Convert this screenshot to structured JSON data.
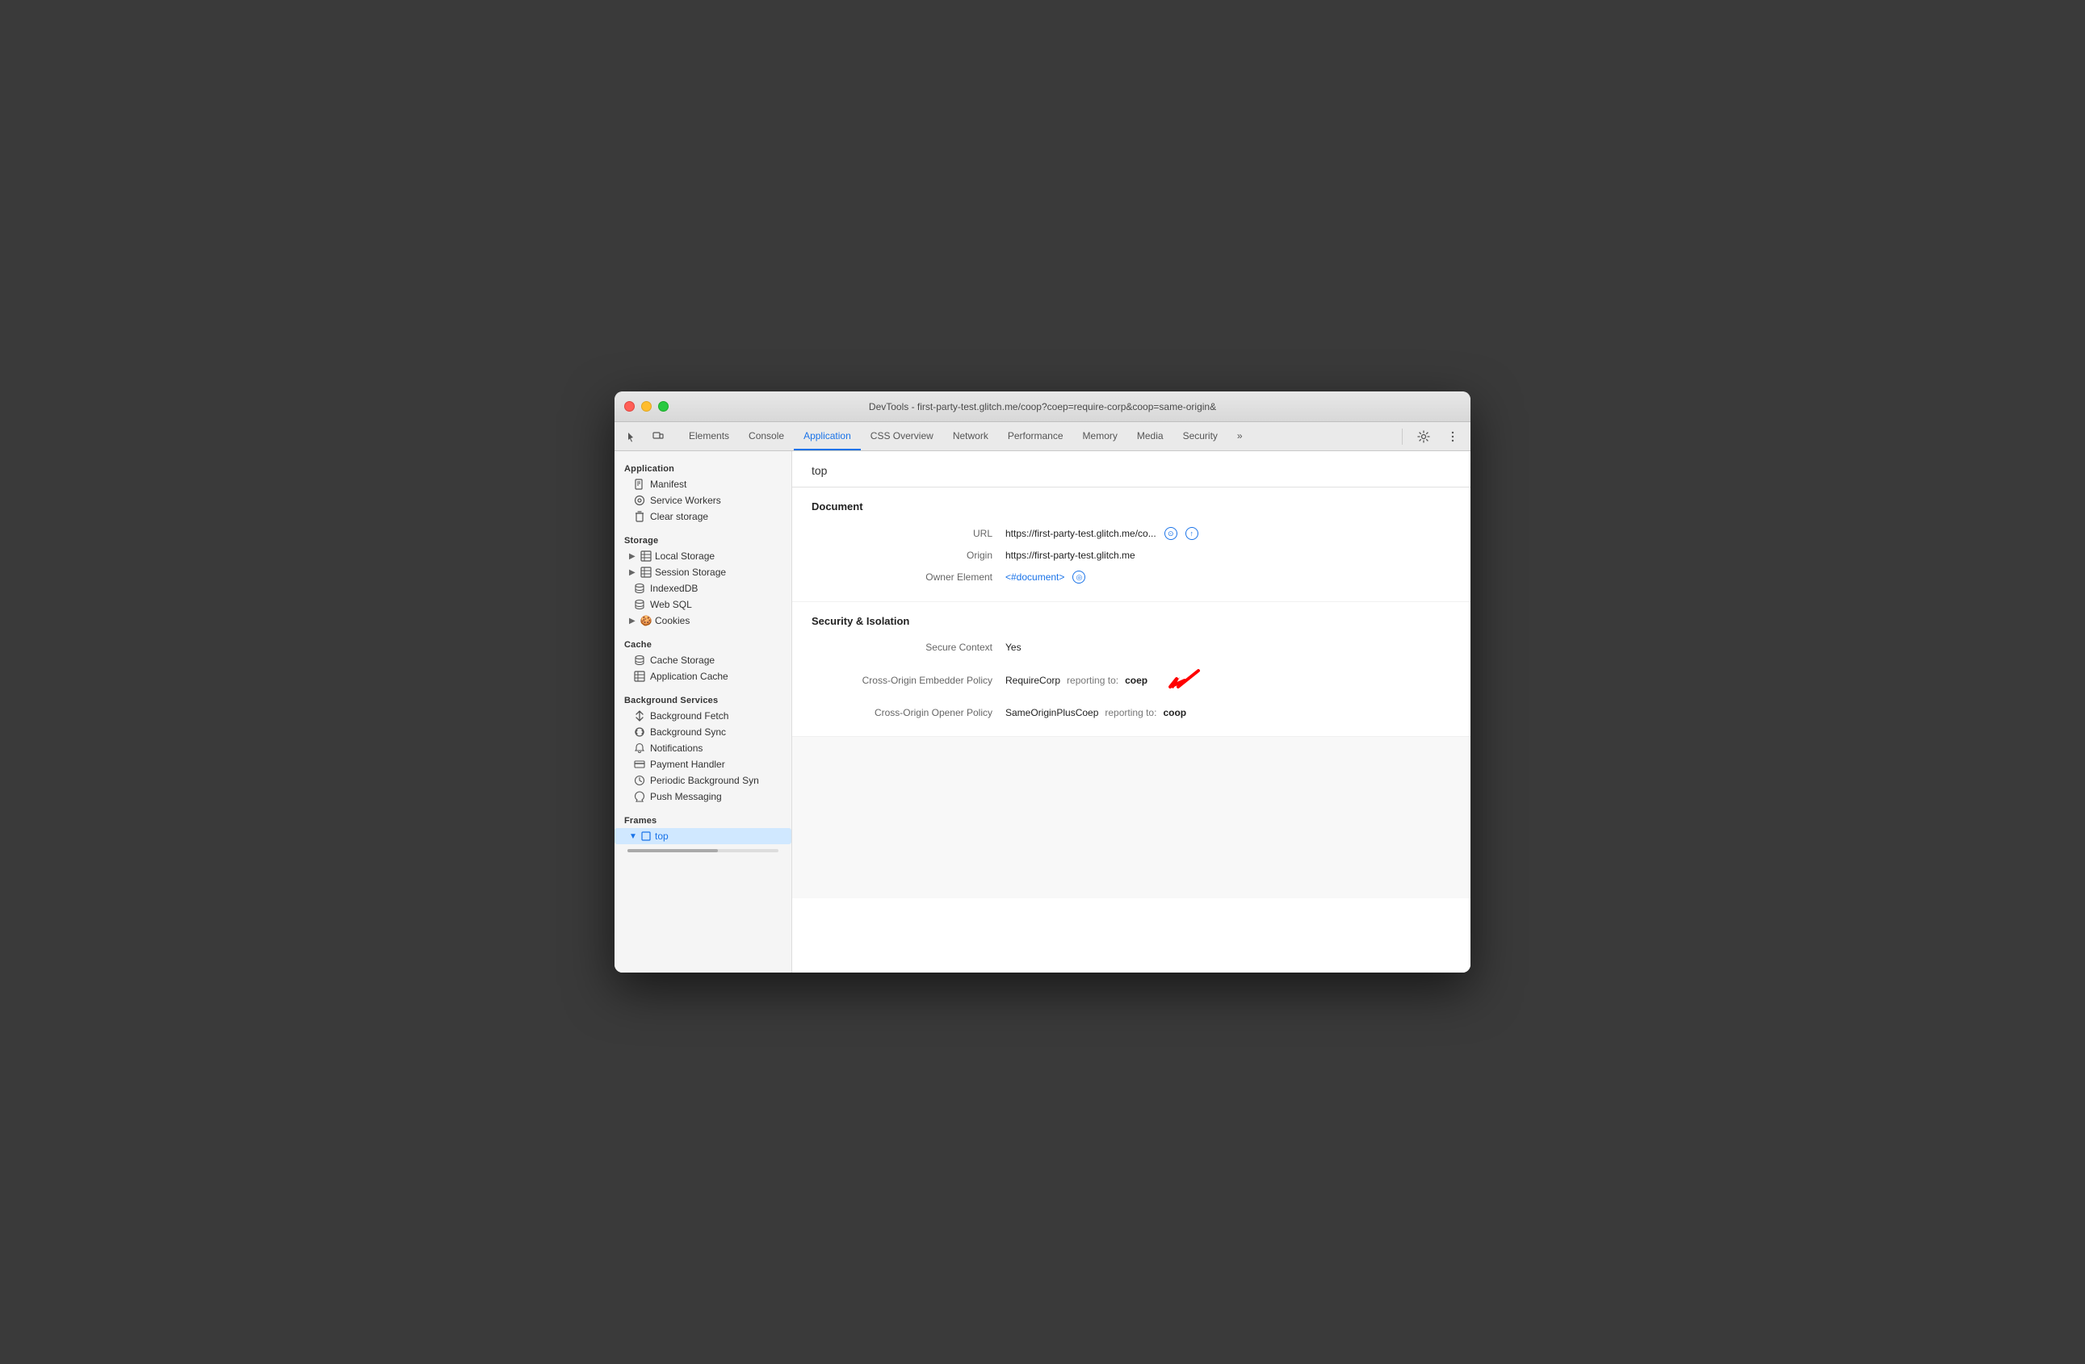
{
  "window": {
    "title": "DevTools - first-party-test.glitch.me/coop?coep=require-corp&coop=same-origin&"
  },
  "tabs": [
    {
      "id": "elements",
      "label": "Elements",
      "active": false
    },
    {
      "id": "console",
      "label": "Console",
      "active": false
    },
    {
      "id": "application",
      "label": "Application",
      "active": true
    },
    {
      "id": "css-overview",
      "label": "CSS Overview",
      "active": false
    },
    {
      "id": "network",
      "label": "Network",
      "active": false
    },
    {
      "id": "performance",
      "label": "Performance",
      "active": false
    },
    {
      "id": "memory",
      "label": "Memory",
      "active": false
    },
    {
      "id": "media",
      "label": "Media",
      "active": false
    },
    {
      "id": "security",
      "label": "Security",
      "active": false
    },
    {
      "id": "more",
      "label": "»",
      "active": false
    }
  ],
  "sidebar": {
    "sections": [
      {
        "label": "Application",
        "items": [
          {
            "id": "manifest",
            "label": "Manifest",
            "icon": "📄",
            "indent": 1
          },
          {
            "id": "service-workers",
            "label": "Service Workers",
            "icon": "⚙",
            "indent": 1
          },
          {
            "id": "clear-storage",
            "label": "Clear storage",
            "icon": "🗑",
            "indent": 1
          }
        ]
      },
      {
        "label": "Storage",
        "items": [
          {
            "id": "local-storage",
            "label": "Local Storage",
            "icon": "▶ ⊞",
            "indent": 1,
            "expandable": true
          },
          {
            "id": "session-storage",
            "label": "Session Storage",
            "icon": "▶ ⊞",
            "indent": 1,
            "expandable": true
          },
          {
            "id": "indexeddb",
            "label": "IndexedDB",
            "icon": "🗄",
            "indent": 1
          },
          {
            "id": "web-sql",
            "label": "Web SQL",
            "icon": "🗄",
            "indent": 1
          },
          {
            "id": "cookies",
            "label": "Cookies",
            "icon": "▶ 🍪",
            "indent": 1,
            "expandable": true
          }
        ]
      },
      {
        "label": "Cache",
        "items": [
          {
            "id": "cache-storage",
            "label": "Cache Storage",
            "icon": "🗄",
            "indent": 1
          },
          {
            "id": "application-cache",
            "label": "Application Cache",
            "icon": "⊞",
            "indent": 1
          }
        ]
      },
      {
        "label": "Background Services",
        "items": [
          {
            "id": "background-fetch",
            "label": "Background Fetch",
            "icon": "↕",
            "indent": 1
          },
          {
            "id": "background-sync",
            "label": "Background Sync",
            "icon": "↺",
            "indent": 1
          },
          {
            "id": "notifications",
            "label": "Notifications",
            "icon": "🔔",
            "indent": 1
          },
          {
            "id": "payment-handler",
            "label": "Payment Handler",
            "icon": "▭",
            "indent": 1
          },
          {
            "id": "periodic-background-sync",
            "label": "Periodic Background Syn",
            "icon": "⏱",
            "indent": 1
          },
          {
            "id": "push-messaging",
            "label": "Push Messaging",
            "icon": "☁",
            "indent": 1
          }
        ]
      },
      {
        "label": "Frames",
        "items": [
          {
            "id": "top",
            "label": "top",
            "icon": "▼ ☐",
            "indent": 0,
            "active": true
          }
        ]
      }
    ]
  },
  "content": {
    "page_title": "top",
    "document_section": {
      "title": "Document",
      "fields": [
        {
          "label": "URL",
          "value": "https://first-party-test.glitch.me/co...",
          "has_icons": true
        },
        {
          "label": "Origin",
          "value": "https://first-party-test.glitch.me",
          "has_icons": false
        },
        {
          "label": "Owner Element",
          "value": "<#document>",
          "is_link": true,
          "has_circle_icon": true
        }
      ]
    },
    "security_section": {
      "title": "Security & Isolation",
      "fields": [
        {
          "label": "Secure Context",
          "value": "Yes",
          "has_icons": false
        },
        {
          "label": "Cross-Origin Embedder Policy",
          "policy": "RequireCorp",
          "reporting_label": "reporting to:",
          "reporting_value": "coep",
          "has_red_arrow": true
        },
        {
          "label": "Cross-Origin Opener Policy",
          "policy": "SameOriginPlusCoep",
          "reporting_label": "reporting to:",
          "reporting_value": "coop",
          "has_red_arrow": false
        }
      ]
    }
  }
}
